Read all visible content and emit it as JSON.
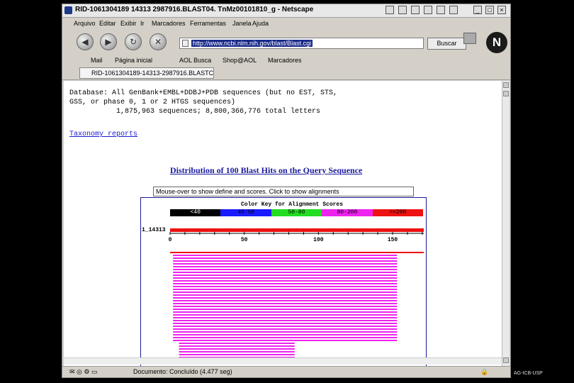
{
  "window": {
    "title": "RID-1061304189 14313 2987916.BLAST04. TnMz00101810_g - Netscape",
    "menu": [
      "Arquivo",
      "Editar",
      "Exibir",
      "Ir",
      "Marcadores",
      "Ferramentas",
      "Janela",
      "Ajuda"
    ],
    "url": "http://www.ncbi.nlm.nih.gov/blast/Blast.cgi",
    "search_button": "Buscar",
    "personal_toolbar": [
      "Mail",
      "Página inicial",
      "AOL Busca",
      "Shop@AOL",
      "Marcadores"
    ],
    "tab_title": "RID-1061304189-14313-2987916.BLASTC...",
    "status_text": "Documento: Concluído (4.477 seg)"
  },
  "page": {
    "database_lines": [
      "Database: All GenBank+EMBL+DDBJ+PDB sequences (but no EST, STS,",
      "GSS, or phase 0, 1 or 2 HTGS sequences)",
      "           1,875,963 sequences; 8,800,366,776 total letters"
    ],
    "taxonomy_link": "Taxonomy reports",
    "distribution_title": "Distribution of 100 Blast Hits on the Query Sequence",
    "mouseover_text": "Mouse-over to show define and scores. Click to show alignments"
  },
  "chart_data": {
    "type": "alignment-graph",
    "color_key_title": "Color Key for Alignment Scores",
    "color_key": [
      {
        "label": "<40",
        "color": "#000000",
        "text_color": "#ffffff"
      },
      {
        "label": "40-50",
        "color": "#1a1aff",
        "text_color": "#000000"
      },
      {
        "label": "50-80",
        "color": "#22dd22",
        "text_color": "#000000"
      },
      {
        "label": "80-200",
        "color": "#ee22ee",
        "text_color": "#000000"
      },
      {
        "label": ">=200",
        "color": "#ee1111",
        "text_color": "#000000"
      }
    ],
    "query_label": "1_14313",
    "query_length": 171,
    "ticks": [
      0,
      50,
      100,
      150
    ],
    "hit_groups": [
      {
        "count": 1,
        "start": 0,
        "end": 171,
        "color": "#ee1111"
      },
      {
        "count": 31,
        "start": 2,
        "end": 153,
        "color": "#ee22ee"
      },
      {
        "count": 8,
        "start": 6,
        "end": 84,
        "color": "#ee22ee"
      }
    ]
  },
  "footer": {
    "corner_text": "AG-ICB-USP"
  }
}
